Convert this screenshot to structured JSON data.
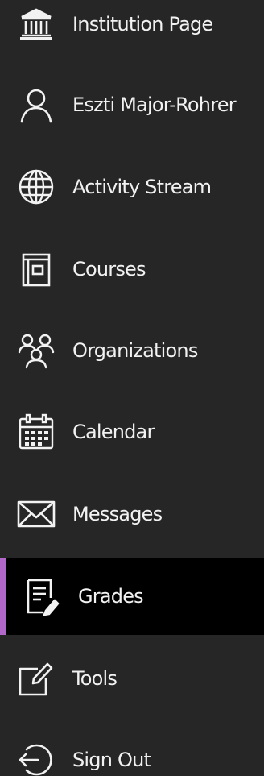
{
  "nav": {
    "items": [
      {
        "label": "Institution Page",
        "icon": "institution-icon"
      },
      {
        "label": "Eszti Major-Rohrer",
        "icon": "user-icon"
      },
      {
        "label": "Activity Stream",
        "icon": "globe-icon"
      },
      {
        "label": "Courses",
        "icon": "courses-icon"
      },
      {
        "label": "Organizations",
        "icon": "organizations-icon"
      },
      {
        "label": "Calendar",
        "icon": "calendar-icon"
      },
      {
        "label": "Messages",
        "icon": "envelope-icon"
      },
      {
        "label": "Grades",
        "icon": "grades-icon",
        "active": true
      },
      {
        "label": "Tools",
        "icon": "tools-icon"
      },
      {
        "label": "Sign Out",
        "icon": "sign-out-icon"
      }
    ]
  },
  "colors": {
    "background": "#262626",
    "active_background": "#000000",
    "active_accent": "#b168c9",
    "text": "#f2f2f2"
  }
}
